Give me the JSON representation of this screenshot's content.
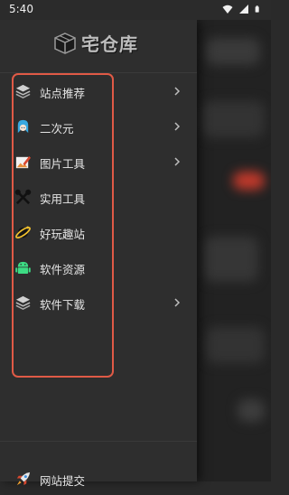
{
  "status_bar": {
    "time": "5:40",
    "icons": [
      "wifi-icon",
      "signal-icon",
      "battery-icon"
    ]
  },
  "drawer": {
    "logo_text": "宅仓库",
    "menu_items": [
      {
        "label": "站点推荐",
        "icon": "layers-icon",
        "has_chevron": true
      },
      {
        "label": "二次元",
        "icon": "anime-girl-icon",
        "has_chevron": true
      },
      {
        "label": "图片工具",
        "icon": "image-edit-icon",
        "has_chevron": true
      },
      {
        "label": "实用工具",
        "icon": "tools-icon",
        "has_chevron": false
      },
      {
        "label": "好玩趣站",
        "icon": "planet-icon",
        "has_chevron": false
      },
      {
        "label": "软件资源",
        "icon": "android-icon",
        "has_chevron": false
      },
      {
        "label": "软件下载",
        "icon": "layers-icon",
        "has_chevron": true
      }
    ],
    "submit": {
      "label": "网站提交",
      "icon": "rocket-icon"
    }
  },
  "colors": {
    "drawer_bg": "#2e2e2e",
    "highlight_border": "#e05a46",
    "background_accent": "#c0392b"
  }
}
